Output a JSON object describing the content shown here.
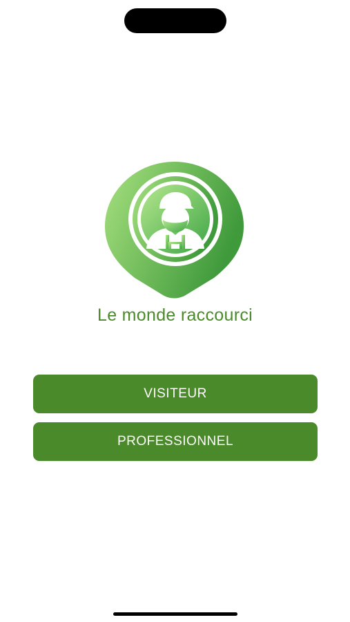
{
  "app": {
    "name": "Le monde raccourci",
    "logo_icon": "map-pin-worker-icon",
    "brand_color": "#4b8a2b",
    "logo_gradient": [
      "#a6e07e",
      "#3f9a3a"
    ]
  },
  "actions": {
    "visitor_label": "VISITEUR",
    "professional_label": "PROFESSIONNEL"
  }
}
